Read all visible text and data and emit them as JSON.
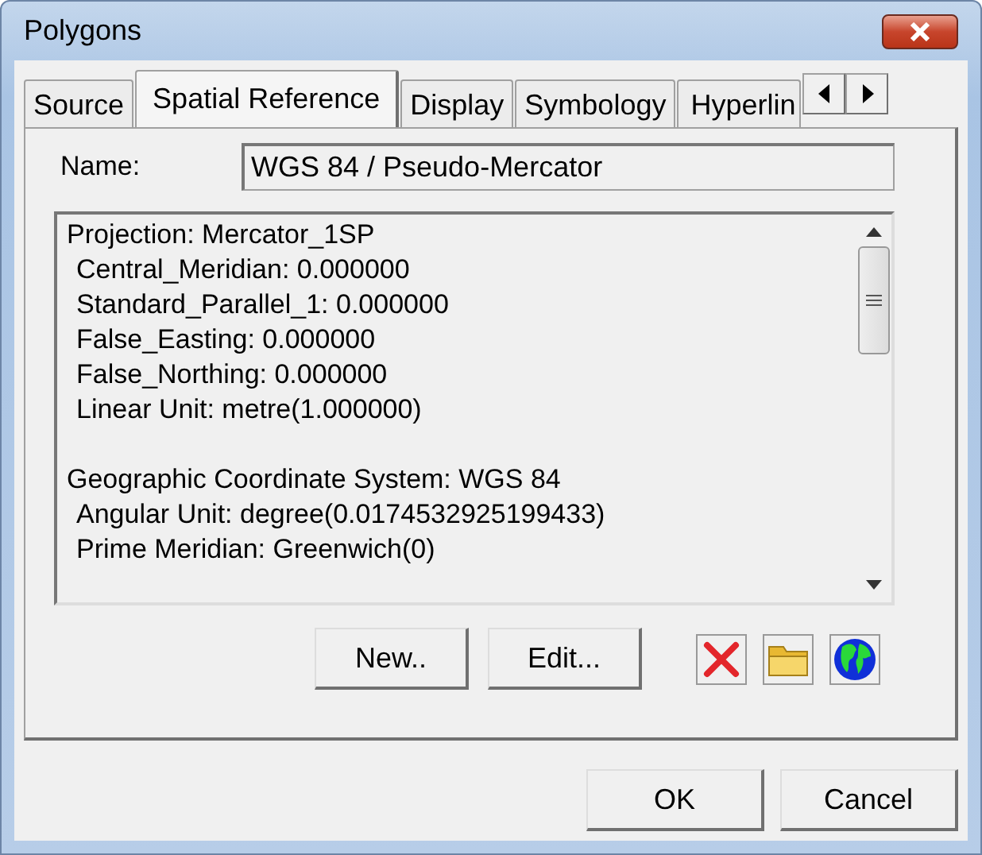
{
  "window": {
    "title": "Polygons"
  },
  "tabs": [
    {
      "label": "Source",
      "selected": false
    },
    {
      "label": "Spatial Reference",
      "selected": true
    },
    {
      "label": "Display",
      "selected": false
    },
    {
      "label": "Symbology",
      "selected": false
    },
    {
      "label": "Hyperlin",
      "selected": false
    }
  ],
  "name_field": {
    "label": "Name:",
    "value": "WGS 84 / Pseudo-Mercator"
  },
  "details": [
    {
      "lines": [
        {
          "kind": "heading",
          "text": "Projection: Mercator_1SP"
        },
        {
          "kind": "param",
          "text": "Central_Meridian: 0.000000"
        },
        {
          "kind": "param",
          "text": "Standard_Parallel_1: 0.000000"
        },
        {
          "kind": "param",
          "text": "False_Easting: 0.000000"
        },
        {
          "kind": "param",
          "text": "False_Northing: 0.000000"
        },
        {
          "kind": "param",
          "text": "Linear Unit: metre(1.000000)"
        }
      ]
    },
    {
      "lines": [
        {
          "kind": "heading",
          "text": "Geographic Coordinate System: WGS 84"
        },
        {
          "kind": "param",
          "text": "Angular Unit: degree(0.0174532925199433)"
        },
        {
          "kind": "param",
          "text": "Prime Meridian: Greenwich(0)"
        }
      ]
    }
  ],
  "actions": [
    "New..",
    "Edit..."
  ],
  "tool_icons": [
    {
      "kind": "delete"
    },
    {
      "kind": "folder"
    },
    {
      "kind": "globe"
    }
  ],
  "buttons": [
    "OK",
    "Cancel"
  ]
}
